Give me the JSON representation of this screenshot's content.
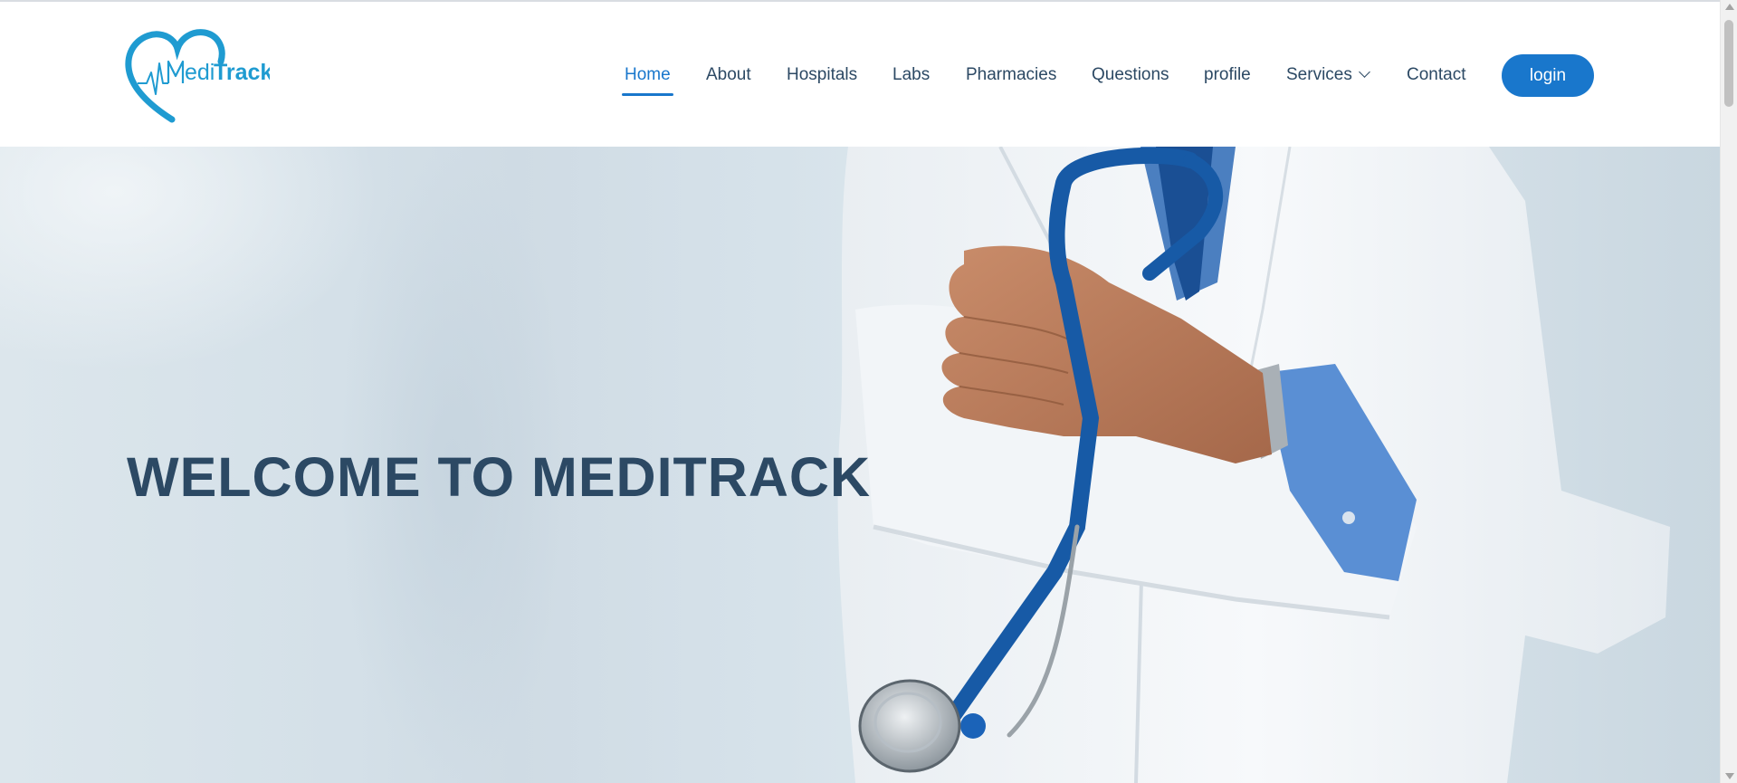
{
  "brand": {
    "logo_text_prefix": "edi",
    "logo_text_suffix": "Track",
    "logo_color": "#1f9bd1",
    "logo_icon": "heart-pulse-icon"
  },
  "nav": {
    "items": [
      {
        "label": "Home",
        "active": true
      },
      {
        "label": "About"
      },
      {
        "label": "Hospitals"
      },
      {
        "label": "Labs"
      },
      {
        "label": "Pharmacies"
      },
      {
        "label": "Questions"
      },
      {
        "label": "profile"
      },
      {
        "label": "Services",
        "has_dropdown": true
      },
      {
        "label": "Contact"
      }
    ],
    "dropdown_icon": "chevron-down-icon",
    "active_color": "#1977cc",
    "text_color": "#2c4964"
  },
  "login": {
    "label": "login",
    "color": "#1977cc"
  },
  "hero": {
    "title": "WELCOME TO MEDITRACK",
    "title_color": "#2c4964",
    "image": "doctor-with-stethoscope-photo"
  }
}
